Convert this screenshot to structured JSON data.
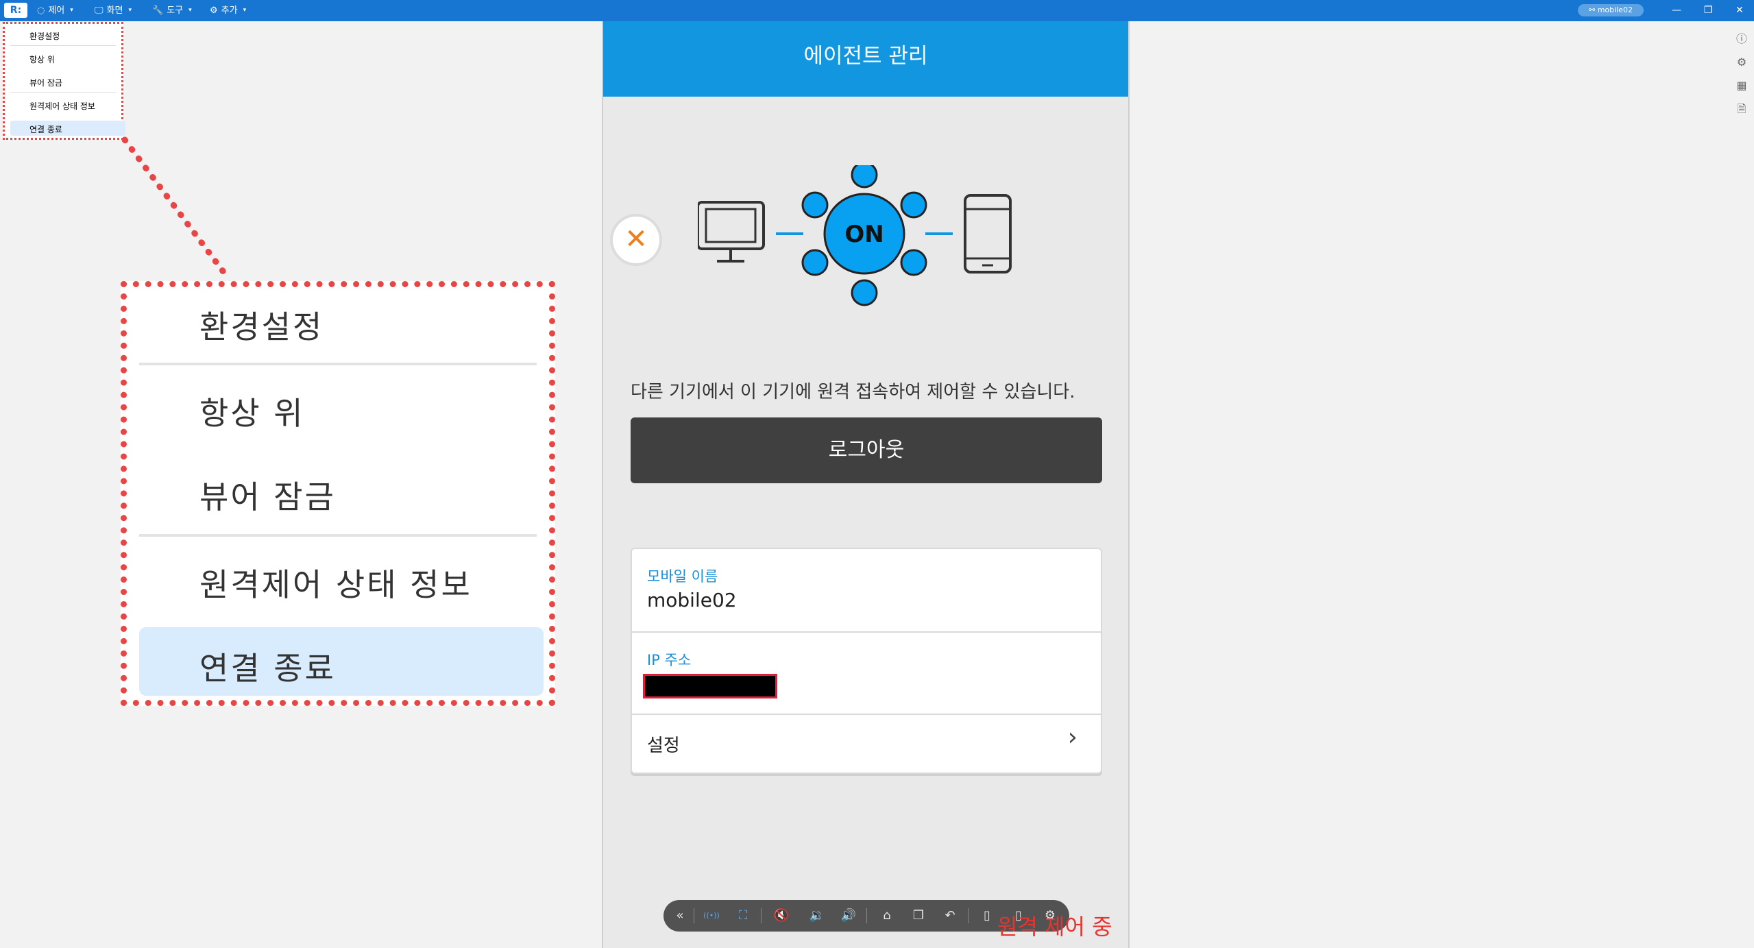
{
  "titlebar": {
    "logo": "R:",
    "menus": [
      {
        "icon": "control-icon",
        "glyph": "◌",
        "label": "제어"
      },
      {
        "icon": "monitor-icon",
        "glyph": "🖵",
        "label": "화면"
      },
      {
        "icon": "wrench-icon",
        "glyph": "🔧",
        "label": "도구"
      },
      {
        "icon": "gear-icon",
        "glyph": "⚙",
        "label": "추가"
      }
    ],
    "device_pill": "mobile02",
    "minimize": "—",
    "restore": "❐",
    "close": "✕"
  },
  "dropdown_small": {
    "items": [
      "환경설정",
      "항상 위",
      "뷰어 잠금",
      "원격제어 상태 정보",
      "연결 종료"
    ],
    "highlighted_index": 4
  },
  "dropdown_big": {
    "items": [
      "환경설정",
      "항상 위",
      "뷰어 잠금",
      "원격제어 상태 정보",
      "연결 종료"
    ],
    "highlighted_index": 4
  },
  "mobile": {
    "header_title": "에이전트 관리",
    "close_glyph": "✕",
    "status_badge": "ON",
    "description": "다른 기기에서 이 기기에 원격 접속하여 제어할 수 있습니다.",
    "logout_label": "로그아웃",
    "info": {
      "name_label": "모바일 이름",
      "name_value": "mobile02",
      "ip_label": "IP 주소",
      "settings_label": "설정",
      "settings_chevron": "›"
    }
  },
  "toolbar": {
    "buttons": [
      {
        "name": "collapse-icon",
        "glyph": "«"
      },
      {
        "name": "signal-icon",
        "glyph": "((•))"
      },
      {
        "name": "fullscreen-icon",
        "glyph": "⛶"
      },
      {
        "name": "mute-icon",
        "glyph": "🔇"
      },
      {
        "name": "volume-down-icon",
        "glyph": "🔉"
      },
      {
        "name": "volume-up-icon",
        "glyph": "🔊"
      },
      {
        "name": "home-icon",
        "glyph": "⌂"
      },
      {
        "name": "recent-apps-icon",
        "glyph": "❐"
      },
      {
        "name": "back-icon",
        "glyph": "↶"
      },
      {
        "name": "screen-capture-icon",
        "glyph": "▯"
      },
      {
        "name": "record-icon",
        "glyph": "▯"
      },
      {
        "name": "settings-icon",
        "glyph": "⚙"
      }
    ],
    "remote_status": "원격 제어 중"
  },
  "side_icons": [
    {
      "name": "info-icon",
      "glyph": "ⓘ"
    },
    {
      "name": "settings-icon",
      "glyph": "⚙"
    },
    {
      "name": "grid-icon",
      "glyph": "▦"
    },
    {
      "name": "document-icon",
      "glyph": "🗎"
    }
  ],
  "colors": {
    "titlebar": "#1776d2",
    "header": "#1296e0",
    "accent_label": "#1b8ed6",
    "highlight": "#dcecfd",
    "callout": "#e84545",
    "logout_bg": "#404040",
    "remote_status": "#e8332e"
  }
}
